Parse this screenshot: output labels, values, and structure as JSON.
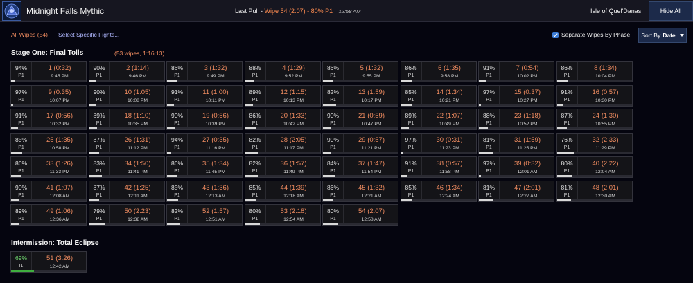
{
  "header": {
    "title": "Midnight Falls Mythic",
    "last_pull_label": "Last Pull -",
    "last_pull_value": "Wipe 54 (2:07) - 80% P1",
    "last_pull_time": "12:58 AM",
    "zone": "Isle of Quel'Danas",
    "hide_all_label": "Hide All"
  },
  "filters": {
    "all_wipes": "All Wipes (54)",
    "select_specific": "Select Specific Fights...",
    "separate_label": "Separate Wipes By Phase",
    "separate_checked": true,
    "sort_prefix": "Sort By",
    "sort_value": "Date"
  },
  "sections": [
    {
      "title": "Stage One: Final Tolls",
      "subtitle": "(53 wipes, 1:16:13)",
      "fights": [
        {
          "pct": "94%",
          "phase": "P1",
          "pull": "1 (0:32)",
          "time": "9:45 PM",
          "progress": 0.06
        },
        {
          "pct": "90%",
          "phase": "P1",
          "pull": "2 (1:14)",
          "time": "9:46 PM",
          "progress": 0.1
        },
        {
          "pct": "86%",
          "phase": "P1",
          "pull": "3 (1:32)",
          "time": "9:49 PM",
          "progress": 0.14
        },
        {
          "pct": "88%",
          "phase": "P1",
          "pull": "4 (1:29)",
          "time": "9:52 PM",
          "progress": 0.12
        },
        {
          "pct": "86%",
          "phase": "P1",
          "pull": "5 (1:32)",
          "time": "9:55 PM",
          "progress": 0.14
        },
        {
          "pct": "86%",
          "phase": "P1",
          "pull": "6 (1:35)",
          "time": "9:58 PM",
          "progress": 0.14
        },
        {
          "pct": "91%",
          "phase": "P1",
          "pull": "7 (0:54)",
          "time": "10:02 PM",
          "progress": 0.09
        },
        {
          "pct": "86%",
          "phase": "P1",
          "pull": "8 (1:34)",
          "time": "10:04 PM",
          "progress": 0.14
        },
        {
          "pct": "97%",
          "phase": "P1",
          "pull": "9 (0:35)",
          "time": "10:07 PM",
          "progress": 0.03
        },
        {
          "pct": "90%",
          "phase": "P1",
          "pull": "10 (1:05)",
          "time": "10:08 PM",
          "progress": 0.1
        },
        {
          "pct": "91%",
          "phase": "P1",
          "pull": "11 (1:00)",
          "time": "10:11 PM",
          "progress": 0.09
        },
        {
          "pct": "89%",
          "phase": "P1",
          "pull": "12 (1:15)",
          "time": "10:13 PM",
          "progress": 0.11
        },
        {
          "pct": "82%",
          "phase": "P1",
          "pull": "13 (1:59)",
          "time": "10:17 PM",
          "progress": 0.18
        },
        {
          "pct": "85%",
          "phase": "P1",
          "pull": "14 (1:34)",
          "time": "10:21 PM",
          "progress": 0.15
        },
        {
          "pct": "97%",
          "phase": "P1",
          "pull": "15 (0:37)",
          "time": "10:27 PM",
          "progress": 0.03
        },
        {
          "pct": "91%",
          "phase": "P1",
          "pull": "16 (0:57)",
          "time": "10:30 PM",
          "progress": 0.09
        },
        {
          "pct": "91%",
          "phase": "P1",
          "pull": "17 (0:56)",
          "time": "10:32 PM",
          "progress": 0.09
        },
        {
          "pct": "89%",
          "phase": "P1",
          "pull": "18 (1:10)",
          "time": "10:35 PM",
          "progress": 0.11
        },
        {
          "pct": "90%",
          "phase": "P1",
          "pull": "19 (0:56)",
          "time": "10:39 PM",
          "progress": 0.1
        },
        {
          "pct": "86%",
          "phase": "P1",
          "pull": "20 (1:33)",
          "time": "10:42 PM",
          "progress": 0.14
        },
        {
          "pct": "90%",
          "phase": "P1",
          "pull": "21 (0:59)",
          "time": "10:47 PM",
          "progress": 0.1
        },
        {
          "pct": "89%",
          "phase": "P1",
          "pull": "22 (1:07)",
          "time": "10:49 PM",
          "progress": 0.11
        },
        {
          "pct": "88%",
          "phase": "P1",
          "pull": "23 (1:18)",
          "time": "10:52 PM",
          "progress": 0.12
        },
        {
          "pct": "87%",
          "phase": "P1",
          "pull": "24 (1:30)",
          "time": "10:55 PM",
          "progress": 0.13
        },
        {
          "pct": "85%",
          "phase": "P1",
          "pull": "25 (1:35)",
          "time": "10:58 PM",
          "progress": 0.15
        },
        {
          "pct": "87%",
          "phase": "P1",
          "pull": "26 (1:31)",
          "time": "11:12 PM",
          "progress": 0.13
        },
        {
          "pct": "94%",
          "phase": "P1",
          "pull": "27 (0:35)",
          "time": "11:16 PM",
          "progress": 0.06
        },
        {
          "pct": "82%",
          "phase": "P1",
          "pull": "28 (2:05)",
          "time": "11:17 PM",
          "progress": 0.18
        },
        {
          "pct": "90%",
          "phase": "P1",
          "pull": "29 (0:57)",
          "time": "11:21 PM",
          "progress": 0.1
        },
        {
          "pct": "97%",
          "phase": "P1",
          "pull": "30 (0:31)",
          "time": "11:23 PM",
          "progress": 0.03
        },
        {
          "pct": "81%",
          "phase": "P1",
          "pull": "31 (1:59)",
          "time": "11:25 PM",
          "progress": 0.19
        },
        {
          "pct": "76%",
          "phase": "P1",
          "pull": "32 (2:33)",
          "time": "11:29 PM",
          "progress": 0.24
        },
        {
          "pct": "86%",
          "phase": "P1",
          "pull": "33 (1:26)",
          "time": "11:33 PM",
          "progress": 0.14
        },
        {
          "pct": "83%",
          "phase": "P1",
          "pull": "34 (1:50)",
          "time": "11:41 PM",
          "progress": 0.17
        },
        {
          "pct": "86%",
          "phase": "P1",
          "pull": "35 (1:34)",
          "time": "11:45 PM",
          "progress": 0.14
        },
        {
          "pct": "82%",
          "phase": "P1",
          "pull": "36 (1:57)",
          "time": "11:49 PM",
          "progress": 0.18
        },
        {
          "pct": "84%",
          "phase": "P1",
          "pull": "37 (1:47)",
          "time": "11:54 PM",
          "progress": 0.16
        },
        {
          "pct": "91%",
          "phase": "P1",
          "pull": "38 (0:57)",
          "time": "11:58 PM",
          "progress": 0.09
        },
        {
          "pct": "97%",
          "phase": "P1",
          "pull": "39 (0:32)",
          "time": "12:01 AM",
          "progress": 0.03
        },
        {
          "pct": "80%",
          "phase": "P1",
          "pull": "40 (2:22)",
          "time": "12:04 AM",
          "progress": 0.2
        },
        {
          "pct": "90%",
          "phase": "P1",
          "pull": "41 (1:07)",
          "time": "12:08 AM",
          "progress": 0.1
        },
        {
          "pct": "87%",
          "phase": "P1",
          "pull": "42 (1:25)",
          "time": "12:11 AM",
          "progress": 0.13
        },
        {
          "pct": "85%",
          "phase": "P1",
          "pull": "43 (1:36)",
          "time": "12:13 AM",
          "progress": 0.15
        },
        {
          "pct": "85%",
          "phase": "P1",
          "pull": "44 (1:39)",
          "time": "12:18 AM",
          "progress": 0.15
        },
        {
          "pct": "86%",
          "phase": "P1",
          "pull": "45 (1:32)",
          "time": "12:21 AM",
          "progress": 0.14
        },
        {
          "pct": "85%",
          "phase": "P1",
          "pull": "46 (1:34)",
          "time": "12:24 AM",
          "progress": 0.15
        },
        {
          "pct": "81%",
          "phase": "P1",
          "pull": "47 (2:01)",
          "time": "12:27 AM",
          "progress": 0.19
        },
        {
          "pct": "81%",
          "phase": "P1",
          "pull": "48 (2:01)",
          "time": "12:30 AM",
          "progress": 0.19
        },
        {
          "pct": "89%",
          "phase": "P1",
          "pull": "49 (1:06)",
          "time": "12:36 AM",
          "progress": 0.11
        },
        {
          "pct": "79%",
          "phase": "P1",
          "pull": "50 (2:23)",
          "time": "12:38 AM",
          "progress": 0.21
        },
        {
          "pct": "82%",
          "phase": "P1",
          "pull": "52 (1:57)",
          "time": "12:51 AM",
          "progress": 0.18
        },
        {
          "pct": "80%",
          "phase": "P1",
          "pull": "53 (2:18)",
          "time": "12:54 AM",
          "progress": 0.2
        },
        {
          "pct": "80%",
          "phase": "P1",
          "pull": "54 (2:07)",
          "time": "12:58 AM",
          "progress": 0.2
        }
      ]
    },
    {
      "title": "Intermission: Total Eclipse",
      "subtitle": "",
      "fights": [
        {
          "pct": "69%",
          "phase": "I1",
          "pull": "51 (3:26)",
          "time": "12:42 AM",
          "progress": 0.31,
          "green": true
        }
      ]
    }
  ]
}
